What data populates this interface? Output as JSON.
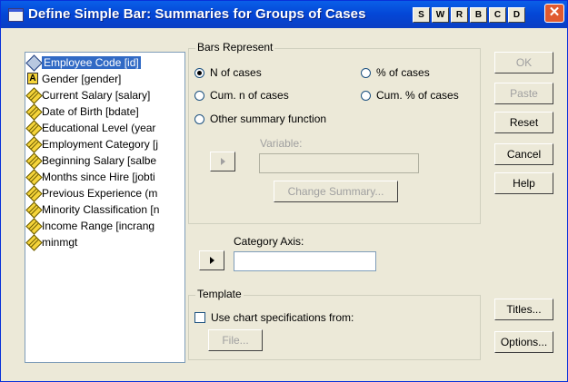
{
  "window": {
    "title": "Define Simple Bar: Summaries for Groups of Cases",
    "toolbar_buttons": [
      "S",
      "W",
      "R",
      "B",
      "C",
      "D"
    ],
    "close_glyph": "✕"
  },
  "variables": [
    {
      "label": "Employee Code [id]",
      "icon": "scale-selected-icon",
      "selected": true
    },
    {
      "label": "Gender [gender]",
      "icon": "nominal-icon"
    },
    {
      "label": "Current Salary [salary]",
      "icon": "scale-icon"
    },
    {
      "label": "Date of Birth [bdate]",
      "icon": "scale-icon"
    },
    {
      "label": "Educational Level (year",
      "icon": "scale-icon"
    },
    {
      "label": "Employment Category [j",
      "icon": "scale-icon"
    },
    {
      "label": "Beginning Salary [salbe",
      "icon": "scale-icon"
    },
    {
      "label": "Months since Hire [jobti",
      "icon": "scale-icon"
    },
    {
      "label": "Previous Experience (m",
      "icon": "scale-icon"
    },
    {
      "label": "Minority Classification [n",
      "icon": "scale-icon"
    },
    {
      "label": "Income Range [incrang",
      "icon": "scale-icon"
    },
    {
      "label": "minmgt",
      "icon": "scale-icon"
    }
  ],
  "bars_represent": {
    "title": "Bars Represent",
    "options": [
      {
        "label": "N of cases",
        "selected": true
      },
      {
        "label": "% of cases",
        "selected": false
      },
      {
        "label": "Cum. n of cases",
        "selected": false
      },
      {
        "label": "Cum. % of cases",
        "selected": false
      },
      {
        "label": "Other summary function",
        "selected": false
      }
    ],
    "variable_label": "Variable:",
    "variable_value": "",
    "change_summary": "Change Summary..."
  },
  "category_axis": {
    "label": "Category Axis:",
    "value": ""
  },
  "template": {
    "title": "Template",
    "use_label": "Use chart specifications from:",
    "checked": false,
    "file_button": "File..."
  },
  "buttons": {
    "ok": "OK",
    "paste": "Paste",
    "reset": "Reset",
    "cancel": "Cancel",
    "help": "Help",
    "titles": "Titles...",
    "options": "Options..."
  }
}
